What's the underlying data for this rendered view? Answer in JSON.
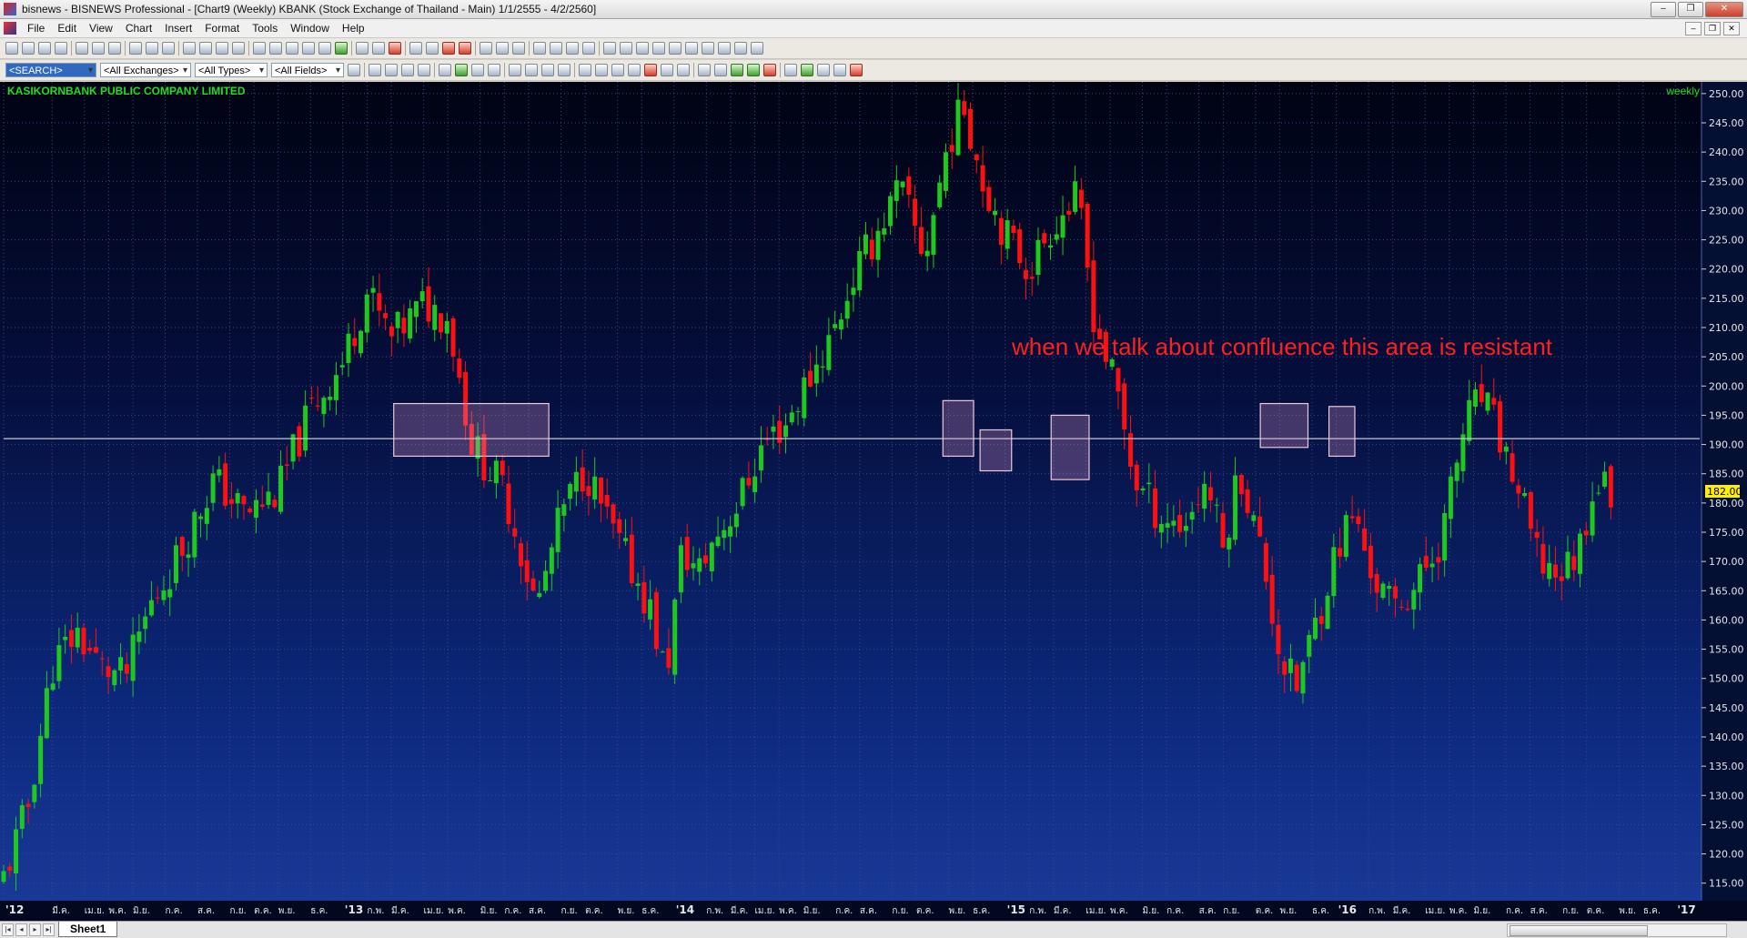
{
  "window": {
    "title": "bisnews - BISNEWS Professional - [Chart9 (Weekly)  KBANK (Stock Exchange of Thailand - Main) 1/1/2555 - 4/2/2560]",
    "controls": [
      "‒",
      "❐",
      "✕"
    ],
    "mdi_controls": [
      "‒",
      "❐",
      "✕"
    ]
  },
  "menu": [
    "File",
    "Edit",
    "View",
    "Chart",
    "Insert",
    "Format",
    "Tools",
    "Window",
    "Help"
  ],
  "toolbar2": {
    "search": "<SEARCH>",
    "exchanges": "<All Exchanges>",
    "types": "<All Types>",
    "fields": "<All Fields>"
  },
  "chart": {
    "company": "KASIKORNBANK PUBLIC COMPANY LIMITED",
    "period": "weekly",
    "annotation": "when we talk about confluence this area is resistant",
    "last_price_label": "182.00"
  },
  "colors": {
    "up": "#1fc81f",
    "down": "#ff1010",
    "resistance_line": "#c8c8d0",
    "zone_border": "#ecc8d8",
    "annotation": "#ff1f1f",
    "last_price_bg": "#ffee00"
  },
  "sheet": {
    "tab": "Sheet1"
  },
  "chart_data": {
    "type": "candlestick",
    "symbol": "KBANK",
    "ylim": [
      112,
      252
    ],
    "grid": true,
    "y_ticks": [
      115,
      120,
      125,
      130,
      135,
      140,
      145,
      150,
      155,
      160,
      165,
      170,
      175,
      180,
      185,
      190,
      195,
      200,
      205,
      210,
      215,
      220,
      225,
      230,
      235,
      240,
      245,
      250
    ],
    "y_tick_labels": [
      "115.00",
      "120.00",
      "125.00",
      "130.00",
      "135.00",
      "140.00",
      "145.00",
      "150.00",
      "155.00",
      "160.00",
      "165.00",
      "170.00",
      "175.00",
      "180.00",
      "185.00",
      "190.00",
      "195.00",
      "200.00",
      "205.00",
      "210.00",
      "215.00",
      "220.00",
      "225.00",
      "230.00",
      "235.00",
      "240.00",
      "245.00",
      "250.00"
    ],
    "x_ticks": [
      {
        "label": "'12",
        "year": true,
        "t": 0.0
      },
      {
        "label": "มี.ค.",
        "t": 0.06
      },
      {
        "label": "เม.ย.",
        "t": 0.1
      },
      {
        "label": "พ.ค.",
        "t": 0.13
      },
      {
        "label": "มิ.ย.",
        "t": 0.16
      },
      {
        "label": "ก.ค.",
        "t": 0.2
      },
      {
        "label": "ส.ค.",
        "t": 0.24
      },
      {
        "label": "ก.ย.",
        "t": 0.28
      },
      {
        "label": "ต.ค.",
        "t": 0.31
      },
      {
        "label": "พ.ย.",
        "t": 0.34
      },
      {
        "label": "ธ.ค.",
        "t": 0.38
      },
      {
        "label": "'13",
        "year": true,
        "t": 0.42
      },
      {
        "label": "ก.พ.",
        "t": 0.45
      },
      {
        "label": "มี.ค.",
        "t": 0.48
      },
      {
        "label": "เม.ย.",
        "t": 0.52
      },
      {
        "label": "พ.ค.",
        "t": 0.55
      },
      {
        "label": "มิ.ย.",
        "t": 0.59
      },
      {
        "label": "ก.ค.",
        "t": 0.62
      },
      {
        "label": "ส.ค.",
        "t": 0.65
      },
      {
        "label": "ก.ย.",
        "t": 0.69
      },
      {
        "label": "ต.ค.",
        "t": 0.72
      },
      {
        "label": "พ.ย.",
        "t": 0.76
      },
      {
        "label": "ธ.ค.",
        "t": 0.79
      },
      {
        "label": "'14",
        "year": true,
        "t": 0.83
      },
      {
        "label": "ก.พ.",
        "t": 0.87
      },
      {
        "label": "มี.ค.",
        "t": 0.9
      },
      {
        "label": "เม.ย.",
        "t": 0.93
      },
      {
        "label": "พ.ค.",
        "t": 0.96
      },
      {
        "label": "มิ.ย.",
        "t": 0.99
      },
      {
        "label": "ก.ค.",
        "t": 1.03
      },
      {
        "label": "ส.ค.",
        "t": 1.06
      },
      {
        "label": "ก.ย.",
        "t": 1.1
      },
      {
        "label": "ต.ค.",
        "t": 1.13
      },
      {
        "label": "พ.ย.",
        "t": 1.17
      },
      {
        "label": "ธ.ค.",
        "t": 1.2
      },
      {
        "label": "'15",
        "year": true,
        "t": 1.24
      },
      {
        "label": "ก.พ.",
        "t": 1.27
      },
      {
        "label": "มี.ค.",
        "t": 1.3
      },
      {
        "label": "เม.ย.",
        "t": 1.34
      },
      {
        "label": "พ.ค.",
        "t": 1.37
      },
      {
        "label": "มิ.ย.",
        "t": 1.41
      },
      {
        "label": "ก.ค.",
        "t": 1.44
      },
      {
        "label": "ส.ค.",
        "t": 1.48
      },
      {
        "label": "ก.ย.",
        "t": 1.51
      },
      {
        "label": "ต.ค.",
        "t": 1.55
      },
      {
        "label": "พ.ย.",
        "t": 1.58
      },
      {
        "label": "ธ.ค.",
        "t": 1.62
      },
      {
        "label": "'16",
        "year": true,
        "t": 1.65
      },
      {
        "label": "ก.พ.",
        "t": 1.69
      },
      {
        "label": "มี.ค.",
        "t": 1.72
      },
      {
        "label": "เม.ย.",
        "t": 1.76
      },
      {
        "label": "พ.ค.",
        "t": 1.79
      },
      {
        "label": "มิ.ย.",
        "t": 1.82
      },
      {
        "label": "ก.ค.",
        "t": 1.86
      },
      {
        "label": "ส.ค.",
        "t": 1.89
      },
      {
        "label": "ก.ย.",
        "t": 1.93
      },
      {
        "label": "ต.ค.",
        "t": 1.96
      },
      {
        "label": "พ.ย.",
        "t": 2.0
      },
      {
        "label": "ธ.ค.",
        "t": 2.03
      },
      {
        "label": "'17",
        "year": true,
        "t": 2.07
      }
    ],
    "close_path": [
      [
        0,
        116
      ],
      [
        0.03,
        128
      ],
      [
        0.06,
        152
      ],
      [
        0.09,
        158
      ],
      [
        0.12,
        152
      ],
      [
        0.15,
        150
      ],
      [
        0.18,
        162
      ],
      [
        0.22,
        172
      ],
      [
        0.26,
        184
      ],
      [
        0.3,
        178
      ],
      [
        0.34,
        182
      ],
      [
        0.38,
        196
      ],
      [
        0.42,
        204
      ],
      [
        0.45,
        216
      ],
      [
        0.48,
        208
      ],
      [
        0.52,
        214
      ],
      [
        0.55,
        212
      ],
      [
        0.58,
        190
      ],
      [
        0.62,
        182
      ],
      [
        0.66,
        162
      ],
      [
        0.69,
        178
      ],
      [
        0.72,
        186
      ],
      [
        0.75,
        176
      ],
      [
        0.78,
        168
      ],
      [
        0.8,
        162
      ],
      [
        0.82,
        150
      ],
      [
        0.84,
        172
      ],
      [
        0.86,
        168
      ],
      [
        0.88,
        174
      ],
      [
        0.91,
        180
      ],
      [
        0.94,
        190
      ],
      [
        0.97,
        194
      ],
      [
        1.0,
        202
      ],
      [
        1.03,
        210
      ],
      [
        1.05,
        218
      ],
      [
        1.08,
        226
      ],
      [
        1.11,
        234
      ],
      [
        1.14,
        222
      ],
      [
        1.17,
        242
      ],
      [
        1.19,
        248
      ],
      [
        1.21,
        236
      ],
      [
        1.24,
        226
      ],
      [
        1.27,
        220
      ],
      [
        1.3,
        228
      ],
      [
        1.33,
        232
      ],
      [
        1.35,
        212
      ],
      [
        1.38,
        198
      ],
      [
        1.4,
        184
      ],
      [
        1.43,
        178
      ],
      [
        1.46,
        176
      ],
      [
        1.49,
        184
      ],
      [
        1.51,
        172
      ],
      [
        1.53,
        186
      ],
      [
        1.56,
        170
      ],
      [
        1.58,
        154
      ],
      [
        1.6,
        148
      ],
      [
        1.63,
        162
      ],
      [
        1.65,
        172
      ],
      [
        1.67,
        178
      ],
      [
        1.7,
        166
      ],
      [
        1.72,
        162
      ],
      [
        1.75,
        166
      ],
      [
        1.78,
        174
      ],
      [
        1.81,
        194
      ],
      [
        1.83,
        198
      ],
      [
        1.85,
        192
      ],
      [
        1.88,
        180
      ],
      [
        1.9,
        170
      ],
      [
        1.93,
        168
      ],
      [
        1.95,
        172
      ],
      [
        1.97,
        184
      ],
      [
        1.99,
        182
      ]
    ],
    "resistance_level": 191,
    "zones": [
      {
        "t0": 0.483,
        "t1": 0.675,
        "top": 197,
        "bottom": 188
      },
      {
        "t0": 1.163,
        "t1": 1.201,
        "top": 197.5,
        "bottom": 188
      },
      {
        "t0": 1.209,
        "t1": 1.248,
        "top": 192.5,
        "bottom": 185.5
      },
      {
        "t0": 1.297,
        "t1": 1.344,
        "top": 195,
        "bottom": 184
      },
      {
        "t0": 1.556,
        "t1": 1.615,
        "top": 197,
        "bottom": 189.5
      },
      {
        "t0": 1.641,
        "t1": 1.673,
        "top": 196.5,
        "bottom": 188
      }
    ],
    "last_price": 182
  }
}
